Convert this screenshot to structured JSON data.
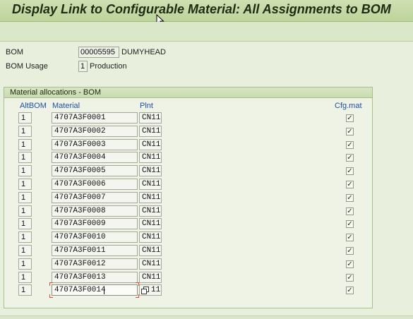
{
  "title": "Display Link to Configurable Material: All Assignments to BOM",
  "header_fields": {
    "bom_label": "BOM",
    "bom_value": "00005595",
    "bom_desc": "DUMYHEAD",
    "usage_label": "BOM Usage",
    "usage_value": "1",
    "usage_desc": "Production"
  },
  "group": {
    "title": "Material allocations - BOM",
    "columns": {
      "altbom": "AltBOM",
      "material": "Material",
      "plnt": "Plnt",
      "cfg": "Cfg.mat"
    }
  },
  "rows": [
    {
      "alt": "1",
      "material": "4707A3F0001",
      "plnt": "CN11",
      "cfg": true
    },
    {
      "alt": "1",
      "material": "4707A3F0002",
      "plnt": "CN11",
      "cfg": true
    },
    {
      "alt": "1",
      "material": "4707A3F0003",
      "plnt": "CN11",
      "cfg": true
    },
    {
      "alt": "1",
      "material": "4707A3F0004",
      "plnt": "CN11",
      "cfg": true
    },
    {
      "alt": "1",
      "material": "4707A3F0005",
      "plnt": "CN11",
      "cfg": true
    },
    {
      "alt": "1",
      "material": "4707A3F0006",
      "plnt": "CN11",
      "cfg": true
    },
    {
      "alt": "1",
      "material": "4707A3F0007",
      "plnt": "CN11",
      "cfg": true
    },
    {
      "alt": "1",
      "material": "4707A3F0008",
      "plnt": "CN11",
      "cfg": true
    },
    {
      "alt": "1",
      "material": "4707A3F0009",
      "plnt": "CN11",
      "cfg": true
    },
    {
      "alt": "1",
      "material": "4707A3F0010",
      "plnt": "CN11",
      "cfg": true
    },
    {
      "alt": "1",
      "material": "4707A3F0011",
      "plnt": "CN11",
      "cfg": true
    },
    {
      "alt": "1",
      "material": "4707A3F0012",
      "plnt": "CN11",
      "cfg": true
    },
    {
      "alt": "1",
      "material": "4707A3F0013",
      "plnt": "CN11",
      "cfg": true
    },
    {
      "alt": "1",
      "material": "4707A3F0014",
      "plnt": "11",
      "cfg": true
    }
  ],
  "checkbox_glyph": "✓",
  "icons": {
    "cursor": "mouse-pointer-icon",
    "value_help": "value-help-icon"
  },
  "colors": {
    "header_green": "#bcd39a",
    "column_header_blue": "#1f4fa3",
    "focus_red": "#e0483a"
  }
}
